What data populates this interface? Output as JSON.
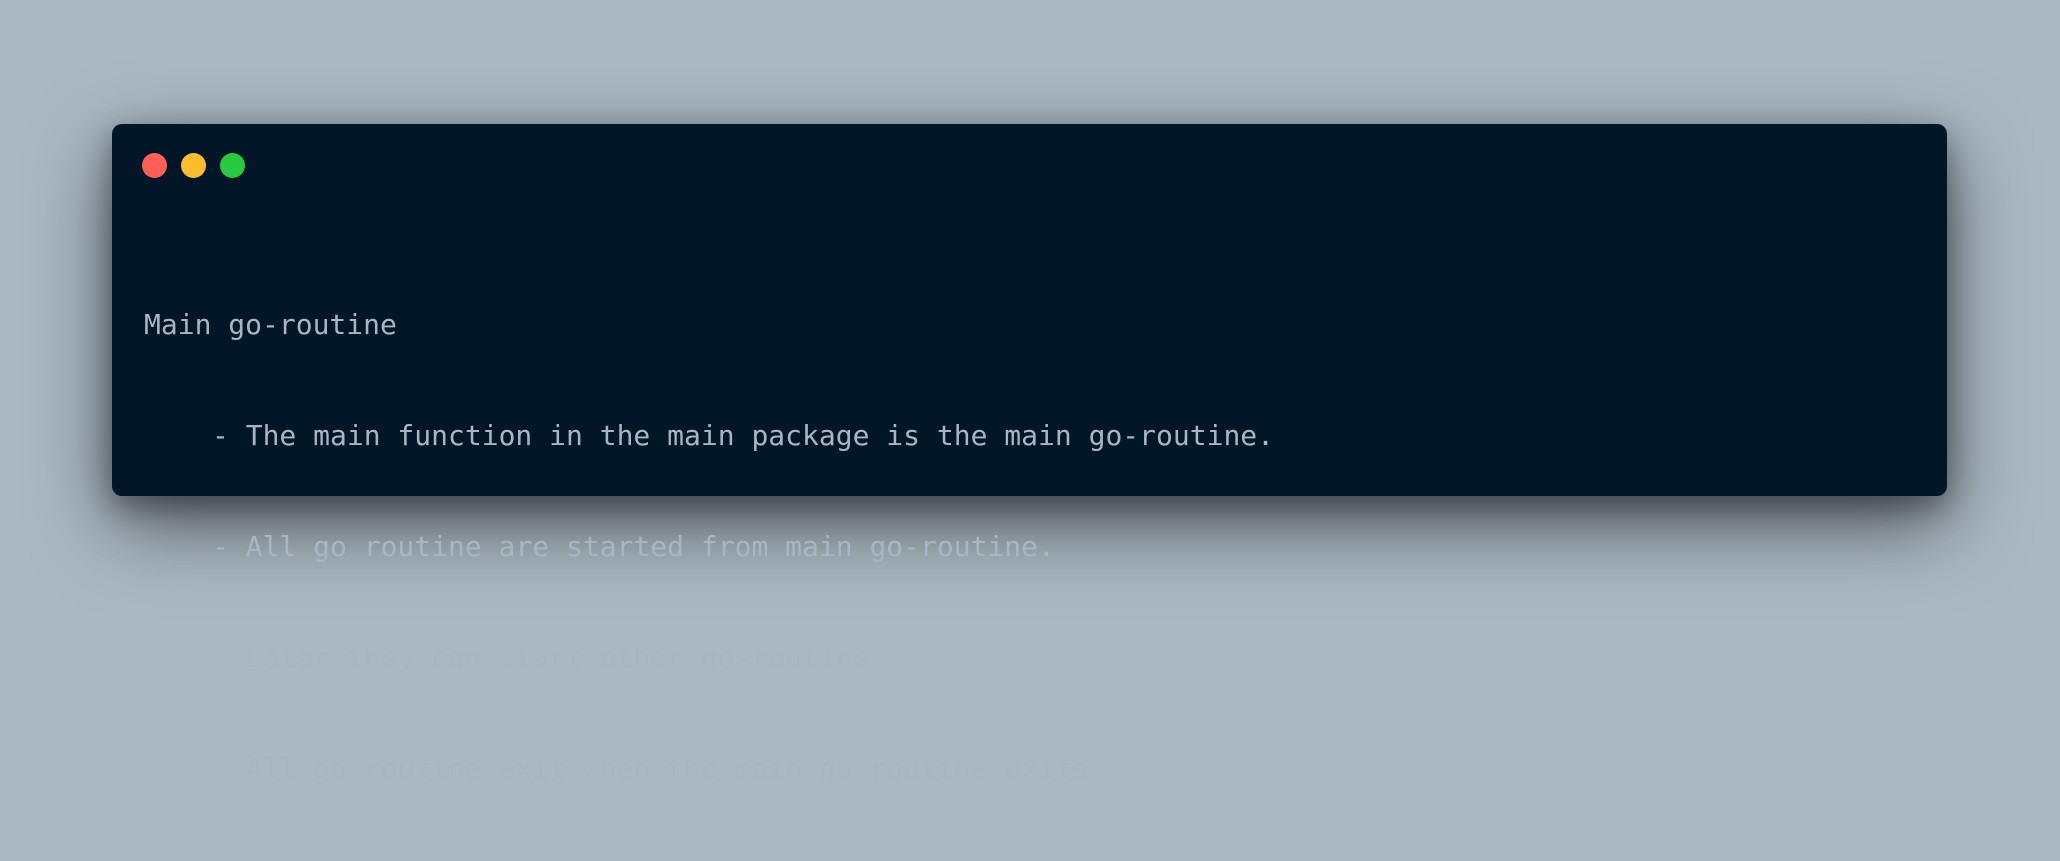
{
  "window": {
    "controls": [
      {
        "name": "close",
        "color": "#ff5f56"
      },
      {
        "name": "minimize",
        "color": "#ffbd2e"
      },
      {
        "name": "zoom",
        "color": "#27c93f"
      }
    ]
  },
  "code": {
    "lines": [
      "Main go-routine",
      "- The main function in the main package is the main go-routine.",
      "- All go routine are started from main go-routine.",
      "- Later they can start other go-routine.",
      "- All go-routine exit when the main go-routine exits."
    ]
  },
  "colors": {
    "background": "#abb8c3",
    "window": "#011627",
    "text": "#a9b5c2"
  }
}
